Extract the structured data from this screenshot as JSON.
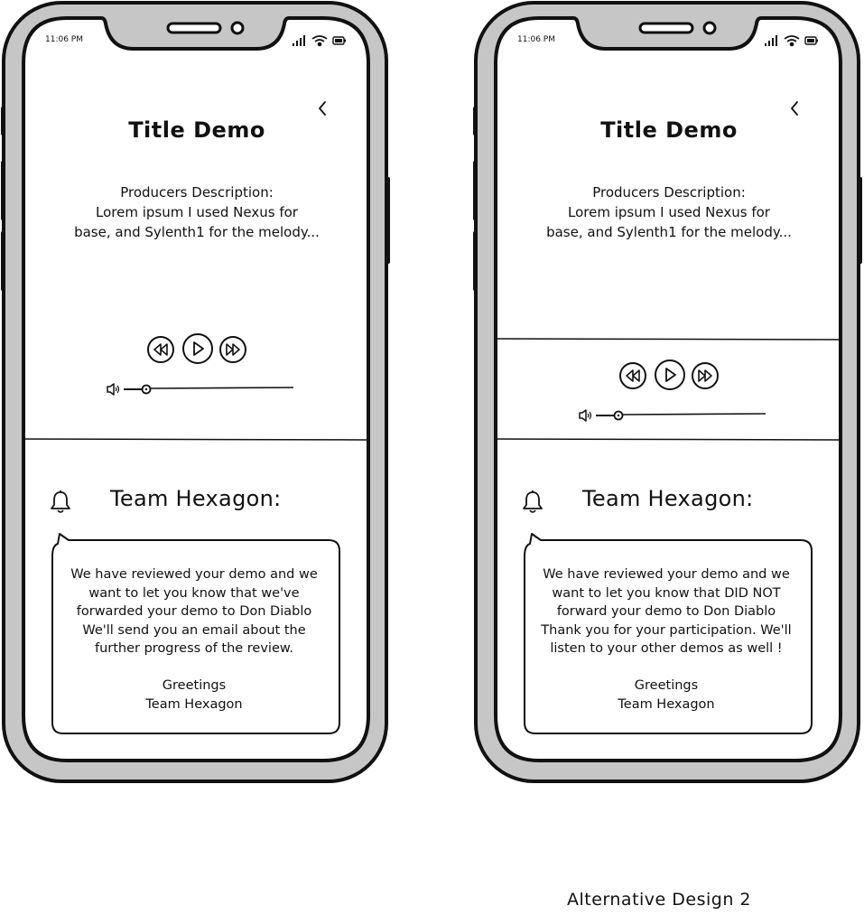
{
  "status_bar": {
    "time": "11:06 PM"
  },
  "screen": {
    "back_icon": "chevron-left-icon",
    "title": "Title Demo",
    "description": [
      "Producers Description:",
      "Lorem ipsum I used Nexus for",
      "base, and Sylenth1 for the melody..."
    ],
    "controls": [
      "rewind-icon",
      "play-icon",
      "fast-forward-icon"
    ],
    "volume_icon": "speaker-icon"
  },
  "notification": {
    "icon": "bell-icon",
    "team": "Team Hexagon:",
    "signoff": [
      "Greetings",
      "Team Hexagon"
    ]
  },
  "designs": [
    {
      "message": [
        "We have reviewed your demo and we",
        "want to let you know that we've",
        "forwarded your demo to Don Diablo",
        "We'll send you an email about the",
        "further progress of the review."
      ]
    },
    {
      "message": [
        "We have reviewed your demo and we",
        "want to let you know that DID NOT",
        "forward your demo to Don Diablo",
        "Thank you for your participation. We'll",
        "listen to your other demos as well !"
      ]
    }
  ],
  "caption": "Alternative Design 2"
}
